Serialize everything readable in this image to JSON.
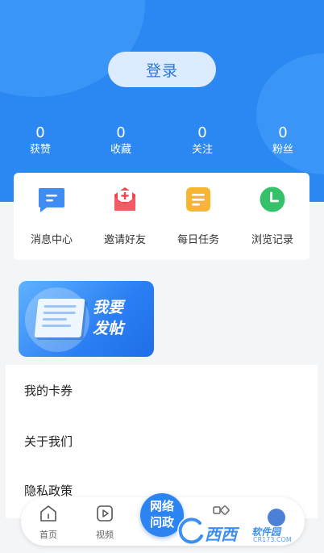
{
  "header": {
    "login_label": "登录"
  },
  "stats": [
    {
      "value": "0",
      "label": "获赞"
    },
    {
      "value": "0",
      "label": "收藏"
    },
    {
      "value": "0",
      "label": "关注"
    },
    {
      "value": "0",
      "label": "粉丝"
    }
  ],
  "quick_actions": [
    {
      "label": "消息中心",
      "icon": "message-icon",
      "color": "#3f8cf3"
    },
    {
      "label": "邀请好友",
      "icon": "invite-icon",
      "color": "#f1464f"
    },
    {
      "label": "每日任务",
      "icon": "task-icon",
      "color": "#f7b631"
    },
    {
      "label": "浏览记录",
      "icon": "clock-icon",
      "color": "#35c06a"
    }
  ],
  "post_banner": {
    "line1": "我要",
    "line2": "发帖"
  },
  "menu": [
    {
      "label": "我的卡券"
    },
    {
      "label": "关于我们"
    },
    {
      "label": "隐私政策"
    }
  ],
  "tabbar": {
    "home_label": "首页",
    "video_label": "视频",
    "center_line1": "网络",
    "center_line2": "问政"
  },
  "watermark": {
    "brand": "西西",
    "site": "软件园",
    "domain": "CR173.COM"
  },
  "colors": {
    "primary": "#2b88f3",
    "background": "#f4f5f7"
  }
}
